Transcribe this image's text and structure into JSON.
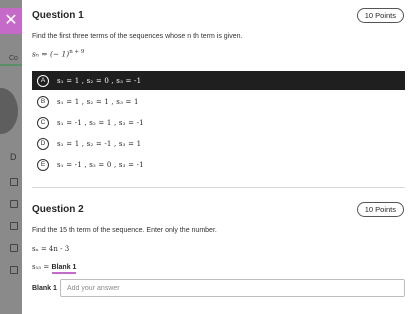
{
  "background": {
    "tab_letter": "Co",
    "side_letter": "D"
  },
  "question1": {
    "title": "Question 1",
    "points": "10 Points",
    "prompt": "Find the first three terms of the sequences whose n th term is given.",
    "formula": "sₙ = (− 1)",
    "formula_exp": "n + 9",
    "options": [
      {
        "letter": "A",
        "selected": true,
        "text": "s₁ = 1 ,  s₂ = 0 ,  s₃ = -1"
      },
      {
        "letter": "B",
        "selected": false,
        "text": "s₁ = 1 ,  s₂ = 1 ,  s₃ = 1"
      },
      {
        "letter": "C",
        "selected": false,
        "text": "s₁ = -1 ,  s₂ = 1 ,  s₃ = -1"
      },
      {
        "letter": "D",
        "selected": false,
        "text": "s₁ = 1 ,  s₂ = -1 ,  s₃ = 1"
      },
      {
        "letter": "E",
        "selected": false,
        "text": "s₁ = -1 ,  s₂ = 0 ,  s₃ = -1"
      }
    ]
  },
  "question2": {
    "title": "Question 2",
    "points": "10 Points",
    "prompt": "Find the 15 th term of the sequence. Enter only the number.",
    "formula": "sₙ = 4n - 3",
    "blank_prefix": "s₁₅ = ",
    "blank_tag": "Blank 1",
    "answer_label": "Blank 1",
    "answer_value": "",
    "answer_placeholder": "Add your answer"
  },
  "colors": {
    "accent": "#c56ac8",
    "selected_bg": "#1f1f1f"
  }
}
